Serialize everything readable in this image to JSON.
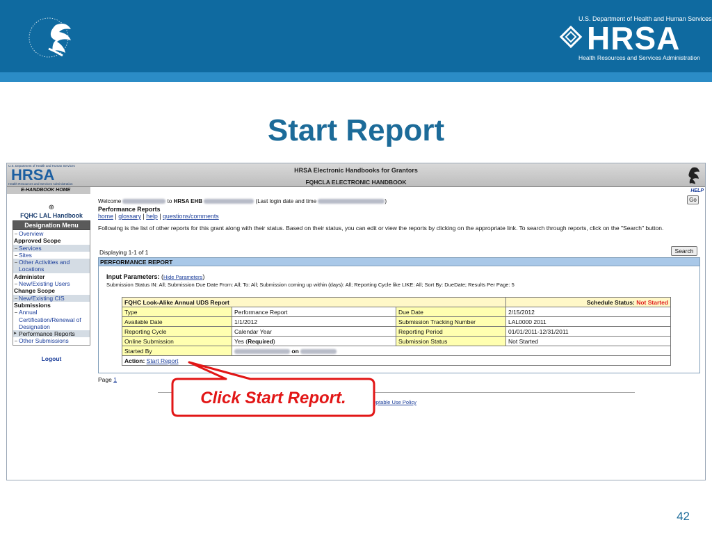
{
  "slide": {
    "title": "Start Report",
    "number": "42"
  },
  "banner": {
    "hrsa_top": "U.S. Department of Health and Human Services",
    "hrsa_word": "HRSA",
    "hrsa_bottom": "Health Resources and Services Administration",
    "band_color": "#0f6aa0",
    "stripe_color": "#2b8cc6"
  },
  "app": {
    "mini_logo_top": "U.S. Department of Health and Human Services",
    "mini_logo_word": "HRSA",
    "mini_logo_bottom": "Health Resources and Services Administration",
    "handbook_home": "E-HANDBOOK HOME",
    "header_line1": "HRSA Electronic Handbooks for Grantors",
    "header_line2": "FQHCLA ELECTRONIC HANDBOOK",
    "help": "HELP"
  },
  "nav": {
    "handbook": "FQHC LAL Handbook",
    "menu_head": "Designation Menu",
    "logout": "Logout",
    "entries": {
      "overview": "Overview",
      "approved_scope": "Approved Scope",
      "services": "Services",
      "sites": "Sites",
      "other_activities": "Other Activities and Locations",
      "administer": "Administer",
      "new_existing_users": "New/Existing Users",
      "change_scope": "Change Scope",
      "new_existing_cis": "New/Existing CIS",
      "submissions": "Submissions",
      "annual_cert": "Annual Certification/Renewal of Designation",
      "performance_reports": "Performance Reports",
      "other_submissions": "Other Submissions"
    }
  },
  "main": {
    "welcome_prefix": "Welcome",
    "welcome_to": "to",
    "welcome_ehb": "HRSA EHB",
    "welcome_last_login": "(Last login date and time",
    "welcome_close": ")",
    "go": "Go",
    "title": "Performance Reports",
    "links": {
      "home": "home",
      "glossary": "glossary",
      "help": "help",
      "questions": "questions/comments",
      "sep": "|"
    },
    "intro": "Following is the list of other reports for this grant along with their status. Based on their status, you can edit or view the reports by clicking on the appropriate link. To search through reports, click on the \"Search\" button.",
    "displaying": "Displaying 1-1 of 1",
    "search": "Search",
    "panel_head": "PERFORMANCE REPORT",
    "input_params_label": "Input Parameters:",
    "hide_params": "Hide Parameters",
    "params_line": "Submission Status IN: All; Submission Due Date From: All; To: All; Submission coming up within (days): All; Reporting Cycle like LIKE: All; Sort By: DueDate; Results Per Page: 5",
    "page_label": "Page",
    "page_number": "1",
    "footer_link": "ceptable Use Policy"
  },
  "report": {
    "name": "FQHC Look-Alike Annual UDS Report",
    "schedule_label": "Schedule Status:",
    "schedule_value": "Not Started",
    "rows": [
      {
        "l1": "Type",
        "v1": "Performance Report",
        "l2": "Due Date",
        "v2": "2/15/2012"
      },
      {
        "l1": "Available Date",
        "v1": "1/1/2012",
        "l2": "Submission Tracking Number",
        "v2": "LAL0000 2011"
      },
      {
        "l1": "Reporting Cycle",
        "v1": "Calendar Year",
        "l2": "Reporting Period",
        "v2": "01/01/2011-12/31/2011"
      },
      {
        "l1": "Online Submission",
        "v1": "Yes",
        "v1b": "Required",
        "l2": "Submission Status",
        "v2": "Not Started"
      }
    ],
    "started_by_label": "Started By",
    "started_on": "on",
    "action_label": "Action:",
    "action_link": "Start Report"
  },
  "callout": {
    "text": "Click Start Report.",
    "color": "#e21616"
  }
}
